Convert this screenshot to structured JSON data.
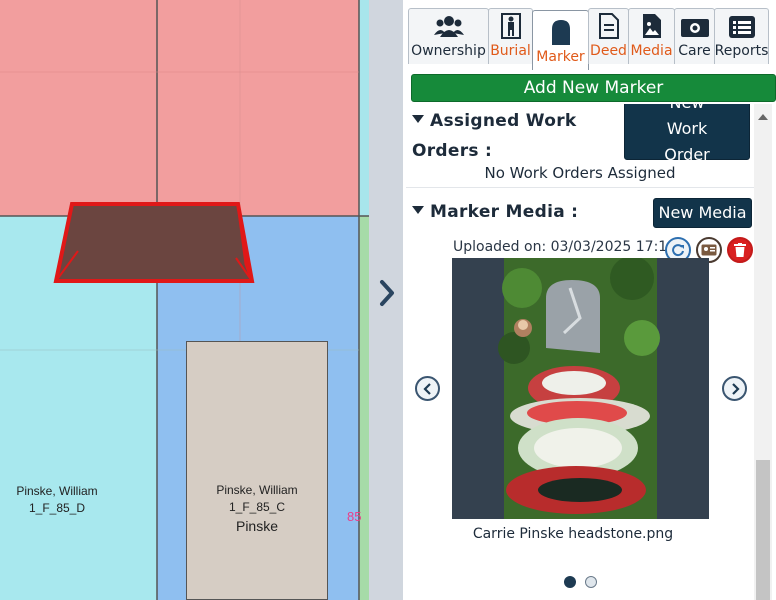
{
  "map": {
    "plots": [
      {
        "name": "Pinske, William",
        "code": "1_F_85_D",
        "extra": ""
      },
      {
        "name": "Pinske, William",
        "code": "1_F_85_C",
        "extra": "Pinske"
      }
    ],
    "row_number": "85",
    "colors": {
      "pink": "#f29e9e",
      "cyan": "#a8e8ee",
      "blue": "#8fbff0",
      "tan": "#d6cdc4",
      "selected": "#6b4540",
      "outline": "#e01818"
    }
  },
  "tabs": [
    {
      "label": "Ownership",
      "icon": "users-icon"
    },
    {
      "label": "Burial",
      "icon": "person-icon"
    },
    {
      "label": "Marker",
      "icon": "headstone-icon"
    },
    {
      "label": "Deed",
      "icon": "document-icon"
    },
    {
      "label": "Media",
      "icon": "image-file-icon"
    },
    {
      "label": "Care",
      "icon": "money-icon"
    },
    {
      "label": "Reports",
      "icon": "list-icon"
    }
  ],
  "active_tab": "Marker",
  "add_marker_label": "Add New Marker",
  "work_orders": {
    "title_line1": "Assigned Work",
    "title_line2": "Orders :",
    "new_button": "New Work Order",
    "empty_text": "No Work Orders Assigned"
  },
  "marker_media": {
    "title": "Marker Media :",
    "new_button": "New Media",
    "uploaded_label": "Uploaded on: 03/03/2025 17:18:",
    "file_name": "Carrie Pinske headstone.png",
    "dots": 2,
    "active_dot": 0
  }
}
